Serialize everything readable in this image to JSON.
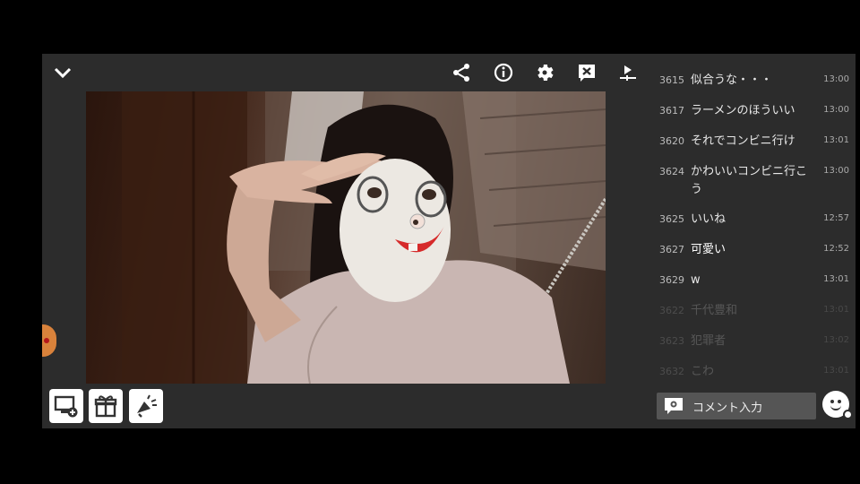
{
  "toolbar": {
    "icons": [
      "chevron-down-icon",
      "share-icon",
      "info-icon",
      "gear-icon",
      "close-comments-icon",
      "timeshift-icon"
    ]
  },
  "bottom_buttons": [
    "monitor-add-icon",
    "gift-icon",
    "megaphone-icon"
  ],
  "comments": [
    {
      "num": "",
      "text": "",
      "time": ""
    },
    {
      "num": "3615",
      "text": "似合うな・・・",
      "time": "13:00"
    },
    {
      "num": "3617",
      "text": "ラーメンのほういい",
      "time": "13:00"
    },
    {
      "num": "3620",
      "text": "それでコンビニ行け",
      "time": "13:01"
    },
    {
      "num": "3624",
      "text": "かわいいコンビニ行こう",
      "time": "13:00"
    },
    {
      "num": "3625",
      "text": "いいね",
      "time": "12:57"
    },
    {
      "num": "3627",
      "text": "可愛い",
      "time": "12:52"
    },
    {
      "num": "3629",
      "text": "w",
      "time": "13:01"
    },
    {
      "num": "3622",
      "text": "千代豊和",
      "time": "13:01"
    },
    {
      "num": "3623",
      "text": "犯罪者",
      "time": "13:02"
    },
    {
      "num": "3632",
      "text": "こわ",
      "time": "13:01"
    }
  ],
  "comment_input": {
    "placeholder": "コメント入力"
  },
  "colors": {
    "panel": "#2c2c2c",
    "accent_orange": "#d9823b",
    "input_bg": "#555555"
  }
}
